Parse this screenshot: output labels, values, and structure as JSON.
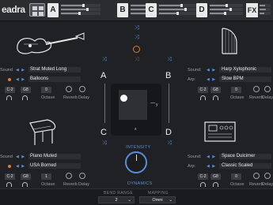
{
  "topbar": {
    "logo": "eadra",
    "slots": [
      {
        "letter": "A",
        "levels": [
          0.55,
          0.65,
          0.45
        ]
      },
      {
        "letter": "B",
        "levels": [
          0.5,
          0.6,
          0.4
        ]
      },
      {
        "letter": "C",
        "levels": [
          0.55,
          0.65,
          0.45
        ]
      },
      {
        "letter": "D",
        "levels": [
          0.5,
          0.6,
          0.45
        ]
      }
    ],
    "fx_label": "FX"
  },
  "layers": {
    "A": {
      "sound_label": "Sound",
      "sound": "Strat Muted Long",
      "arp": "Balloons",
      "range_low": "C-2",
      "range_high": "G8",
      "octave_value": "0",
      "octave_label": "Octave",
      "reverb_label": "Reverb",
      "delay_label": "Delay"
    },
    "B": {
      "sound_label": "Sound:",
      "arp_label": "Arp:",
      "sound": "Harp Xylophonic",
      "arp": "Slow BPM",
      "range_low": "C-2",
      "range_high": "G8",
      "octave_value": "0",
      "octave_label": "Octave",
      "reverb_label": "Reverb",
      "delay_label": "Delay"
    },
    "C": {
      "sound_label": "Sound",
      "sound": "Piano Muted",
      "arp": "USA Borned",
      "range_low": "C-2",
      "range_high": "G8",
      "octave_value": "1",
      "octave_label": "Octave",
      "reverb_label": "Reverb",
      "delay_label": "Delay"
    },
    "D": {
      "sound_label": "Sound:",
      "arp_label": "Arp:",
      "sound": "Space Dulcimer",
      "arp": "Classic Scaled",
      "range_low": "C-2",
      "range_high": "G8",
      "octave_value": "0",
      "octave_label": "Octave",
      "reverb_label": "Reverb",
      "delay_label": "Delay"
    }
  },
  "pad": {
    "letters": [
      "A",
      "B",
      "C",
      "D"
    ],
    "x_label": "x",
    "y_label": "y",
    "intensity_label": "INTENSITY",
    "dynamics_label": "DYNAMICS"
  },
  "bottom": {
    "bend_label": "BEND RANGE",
    "bend_value": "2",
    "mapping_label": "MAPPING",
    "mapping_value": "Omni"
  },
  "colors": {
    "accent_blue": "#5b8bd8",
    "accent_orange": "#e07a2c"
  }
}
